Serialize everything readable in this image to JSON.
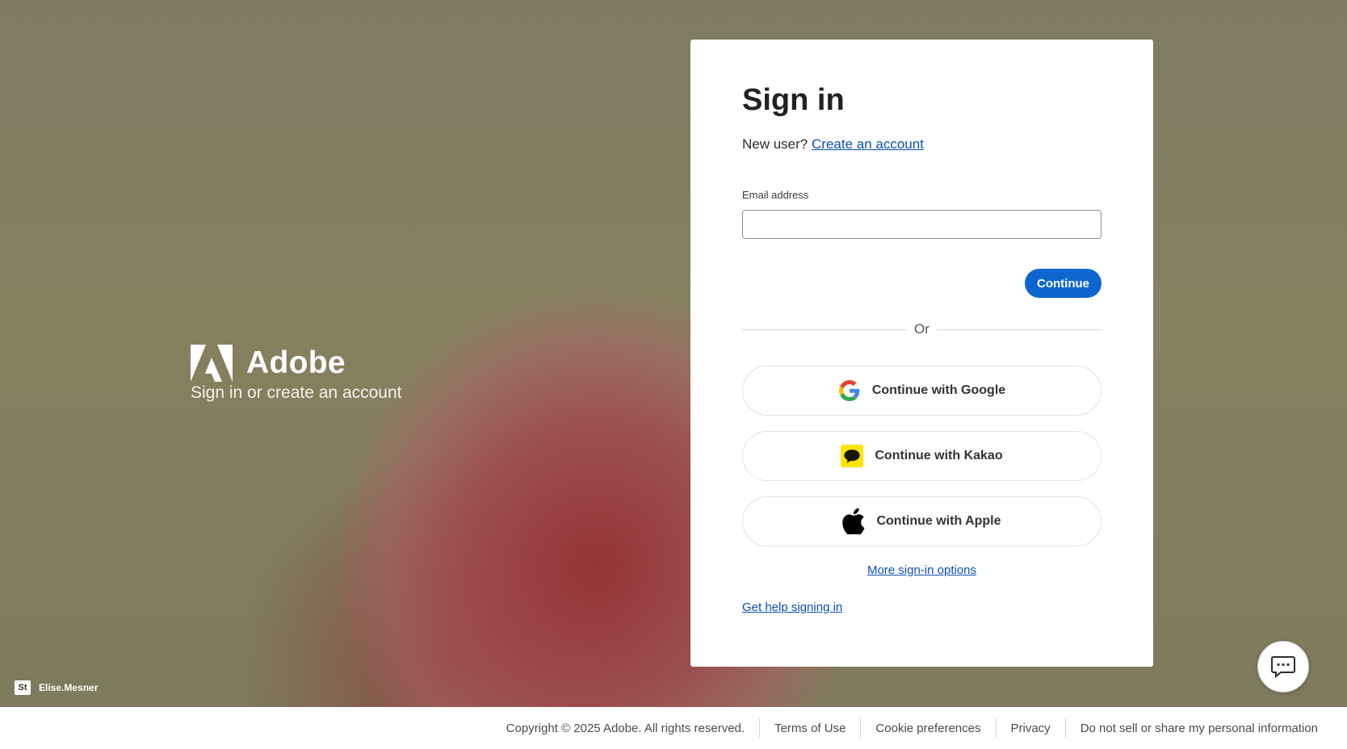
{
  "brand": {
    "name": "Adobe",
    "tagline": "Sign in or create an account"
  },
  "photo_credit": {
    "badge": "St",
    "name": "Elise.Mesner"
  },
  "signin": {
    "title": "Sign in",
    "new_user_text": "New user?",
    "create_account_link": "Create an account",
    "email_label": "Email address",
    "email_value": "",
    "continue_label": "Continue",
    "divider_text": "Or",
    "google_label": "Continue with Google",
    "kakao_label": "Continue with Kakao",
    "apple_label": "Continue with Apple",
    "more_options_link": "More sign-in options",
    "help_link": "Get help signing in"
  },
  "footer": {
    "copyright": "Copyright © 2025 Adobe. All rights reserved.",
    "terms": "Terms of Use",
    "cookies": "Cookie preferences",
    "privacy": "Privacy",
    "do_not_sell": "Do not sell or share my personal information"
  },
  "colors": {
    "primary_button": "#0d66d0",
    "link": "#0b4fb5",
    "kakao_yellow": "#fee500",
    "background": "#7f7a62"
  },
  "icons": {
    "chat": "chat-bubble-icon",
    "google": "google-icon",
    "kakao": "kakao-icon",
    "apple": "apple-icon",
    "adobe": "adobe-logo"
  }
}
